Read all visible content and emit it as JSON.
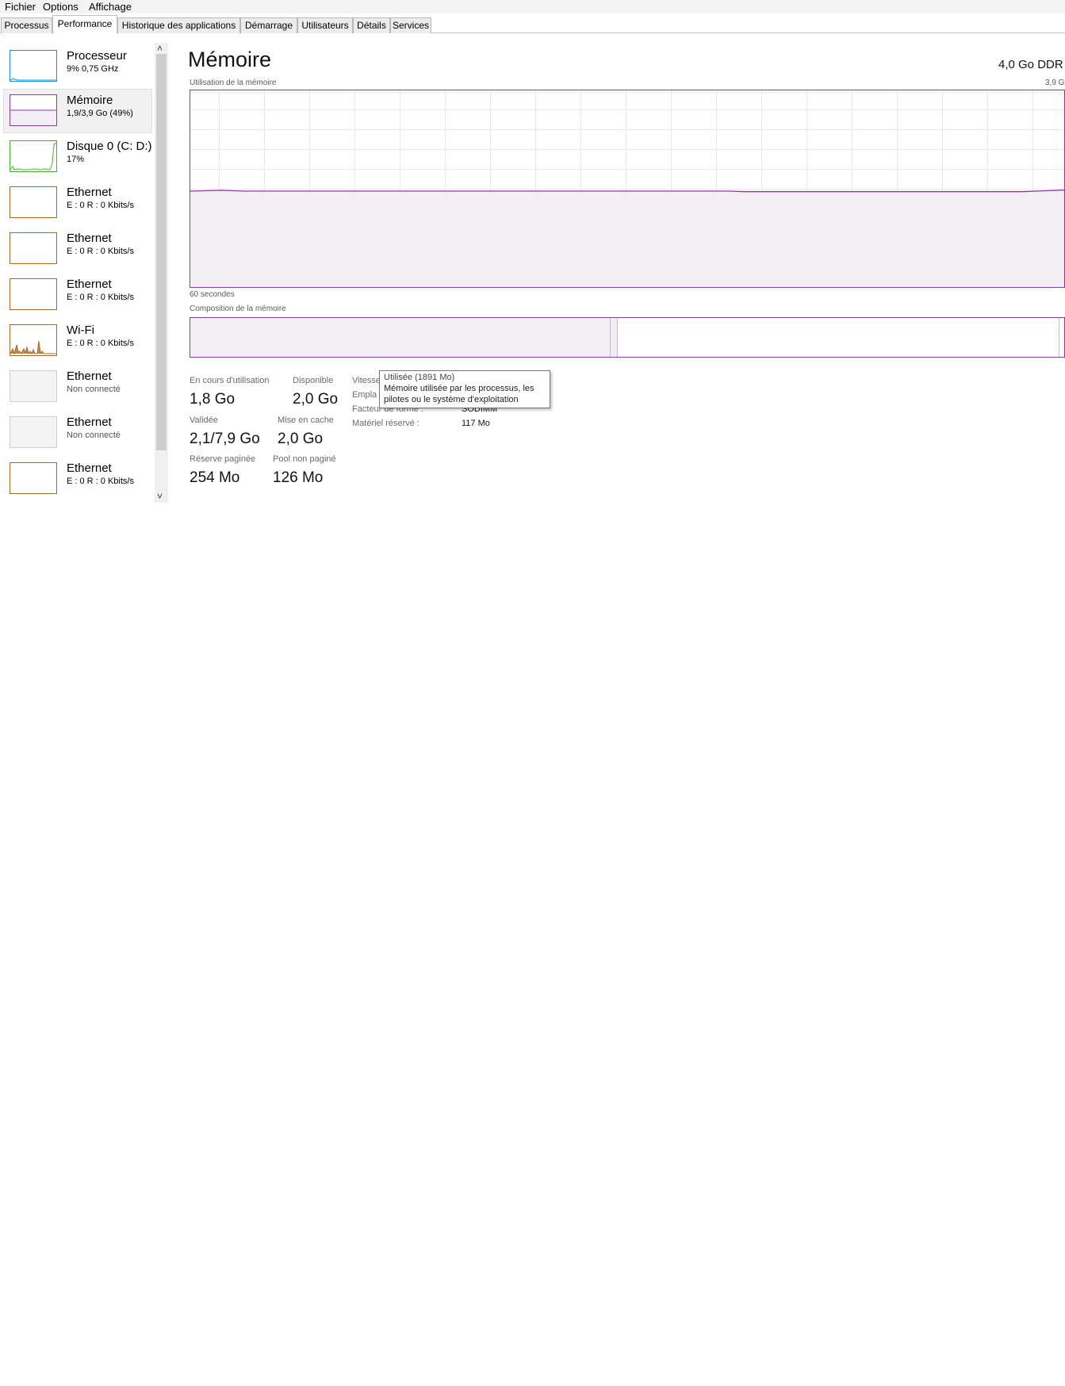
{
  "menu": {
    "items": [
      "Fichier",
      "Options",
      "Affichage"
    ]
  },
  "tabs": [
    {
      "label": "Processus",
      "active": false
    },
    {
      "label": "Performance",
      "active": true
    },
    {
      "label": "Historique des applications",
      "active": false
    },
    {
      "label": "Démarrage",
      "active": false
    },
    {
      "label": "Utilisateurs",
      "active": false
    },
    {
      "label": "Détails",
      "active": false
    },
    {
      "label": "Services",
      "active": false
    }
  ],
  "sidebar": {
    "items": [
      {
        "title": "Processeur",
        "subtitle": "9% 0,75 GHz",
        "icon": "cpu-graph",
        "color": "#1f8fd4"
      },
      {
        "title": "Mémoire",
        "subtitle": "1,9/3,9 Go (49%)",
        "icon": "memory-graph",
        "color": "#8b3d9e"
      },
      {
        "title": "Disque 0 (C: D:)",
        "subtitle": "17%",
        "icon": "disk-graph",
        "color": "#4caf30"
      },
      {
        "title": "Ethernet",
        "subtitle": "E : 0 R : 0 Kbits/s",
        "icon": "network-graph",
        "color": "#a66a2c"
      },
      {
        "title": "Ethernet",
        "subtitle": "E : 0 R : 0 Kbits/s",
        "icon": "network-graph",
        "color": "#a66a2c"
      },
      {
        "title": "Ethernet",
        "subtitle": "E : 0 R : 0 Kbits/s",
        "icon": "network-graph",
        "color": "#a66a2c"
      },
      {
        "title": "Wi-Fi",
        "subtitle": "E : 0 R : 0 Kbits/s",
        "icon": "wifi-graph",
        "color": "#a66a2c"
      },
      {
        "title": "Ethernet",
        "subtitle": "Non connecté",
        "icon": "network-disconnected",
        "color": "#cfcfcf"
      },
      {
        "title": "Ethernet",
        "subtitle": "Non connecté",
        "icon": "network-disconnected",
        "color": "#cfcfcf"
      },
      {
        "title": "Ethernet",
        "subtitle": "E : 0 R : 0 Kbits/s",
        "icon": "network-graph",
        "color": "#a66a2c"
      }
    ],
    "scroll_up": "˄",
    "scroll_down": "˅"
  },
  "main": {
    "title": "Mémoire",
    "spec": "4,0 Go DDR",
    "usage_label": "Utilisation de la mémoire",
    "max_label": "3,9 G",
    "time_label": "60 secondes",
    "composition_label": "Composition de la mémoire",
    "stats": {
      "in_use": {
        "label": "En cours d'utilisation",
        "value": "1,8 Go"
      },
      "available": {
        "label": "Disponible",
        "value": "2,0 Go"
      },
      "committed": {
        "label": "Validée",
        "value": "2,1/7,9 Go"
      },
      "cached": {
        "label": "Mise en cache",
        "value": "2,0 Go"
      },
      "paged_pool": {
        "label": "Réserve paginée",
        "value": "254 Mo"
      },
      "non_paged_pool": {
        "label": "Pool non paginé",
        "value": "126 Mo"
      }
    },
    "details": {
      "speed_label": "Vitesse",
      "slots_label": "Empla",
      "form_factor_label": "Facteur de forme :",
      "form_factor_value": "SODIMM",
      "reserved_label": "Matériel réservé :",
      "reserved_value": "117 Mo"
    },
    "tooltip": {
      "title": "Utilisée (1891 Mo)",
      "line1": "Mémoire utilisée par les processus, les",
      "line2": "pilotes ou le système d'exploitation"
    },
    "usage_percent": 49,
    "accent_color": "#8b3d9e"
  }
}
